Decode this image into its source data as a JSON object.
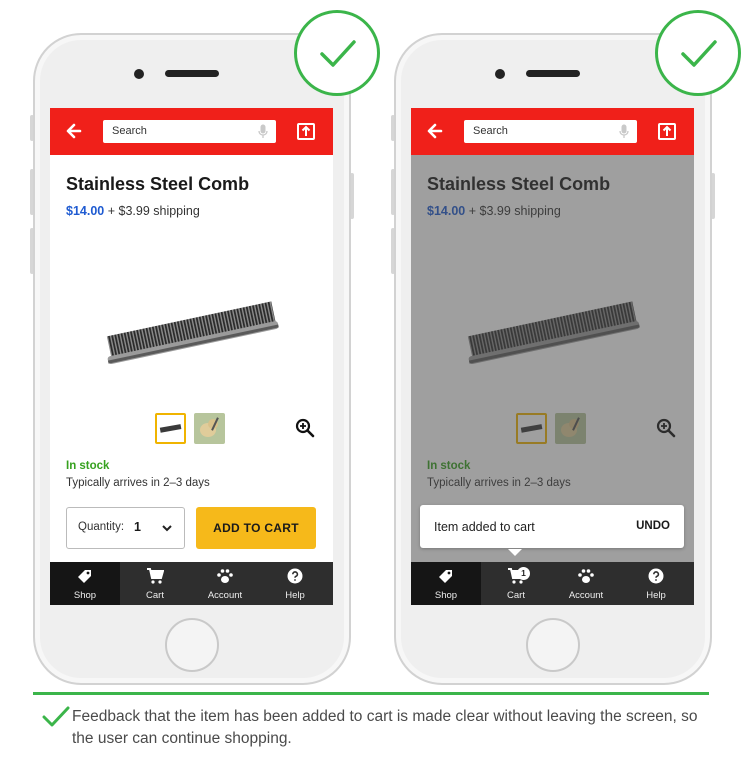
{
  "product": {
    "title": "Stainless Steel Comb",
    "price": "$14.00",
    "shipping": "+ $3.99 shipping",
    "stock": "In stock",
    "arrival": "Typically arrives in 2–3 days"
  },
  "search": {
    "placeholder": "Search"
  },
  "quantity": {
    "label": "Quantity:",
    "value": "1"
  },
  "add_to_cart_label": "ADD TO CART",
  "tabs": [
    {
      "label": "Shop",
      "icon": "tag-icon"
    },
    {
      "label": "Cart",
      "icon": "cart-icon"
    },
    {
      "label": "Account",
      "icon": "paw-icon"
    },
    {
      "label": "Help",
      "icon": "help-icon"
    }
  ],
  "cart_badge": "1",
  "snackbar": {
    "message": "Item added to cart",
    "action": "UNDO"
  },
  "caption": "Feedback that the item has been added to cart is made clear without leaving the screen, so the user can continue shopping.",
  "colors": {
    "brand_red": "#f0201a",
    "price_blue": "#1f5bd1",
    "cta_yellow": "#f6b91a",
    "stock_green": "#36a11f",
    "check_green": "#3bb54a"
  }
}
